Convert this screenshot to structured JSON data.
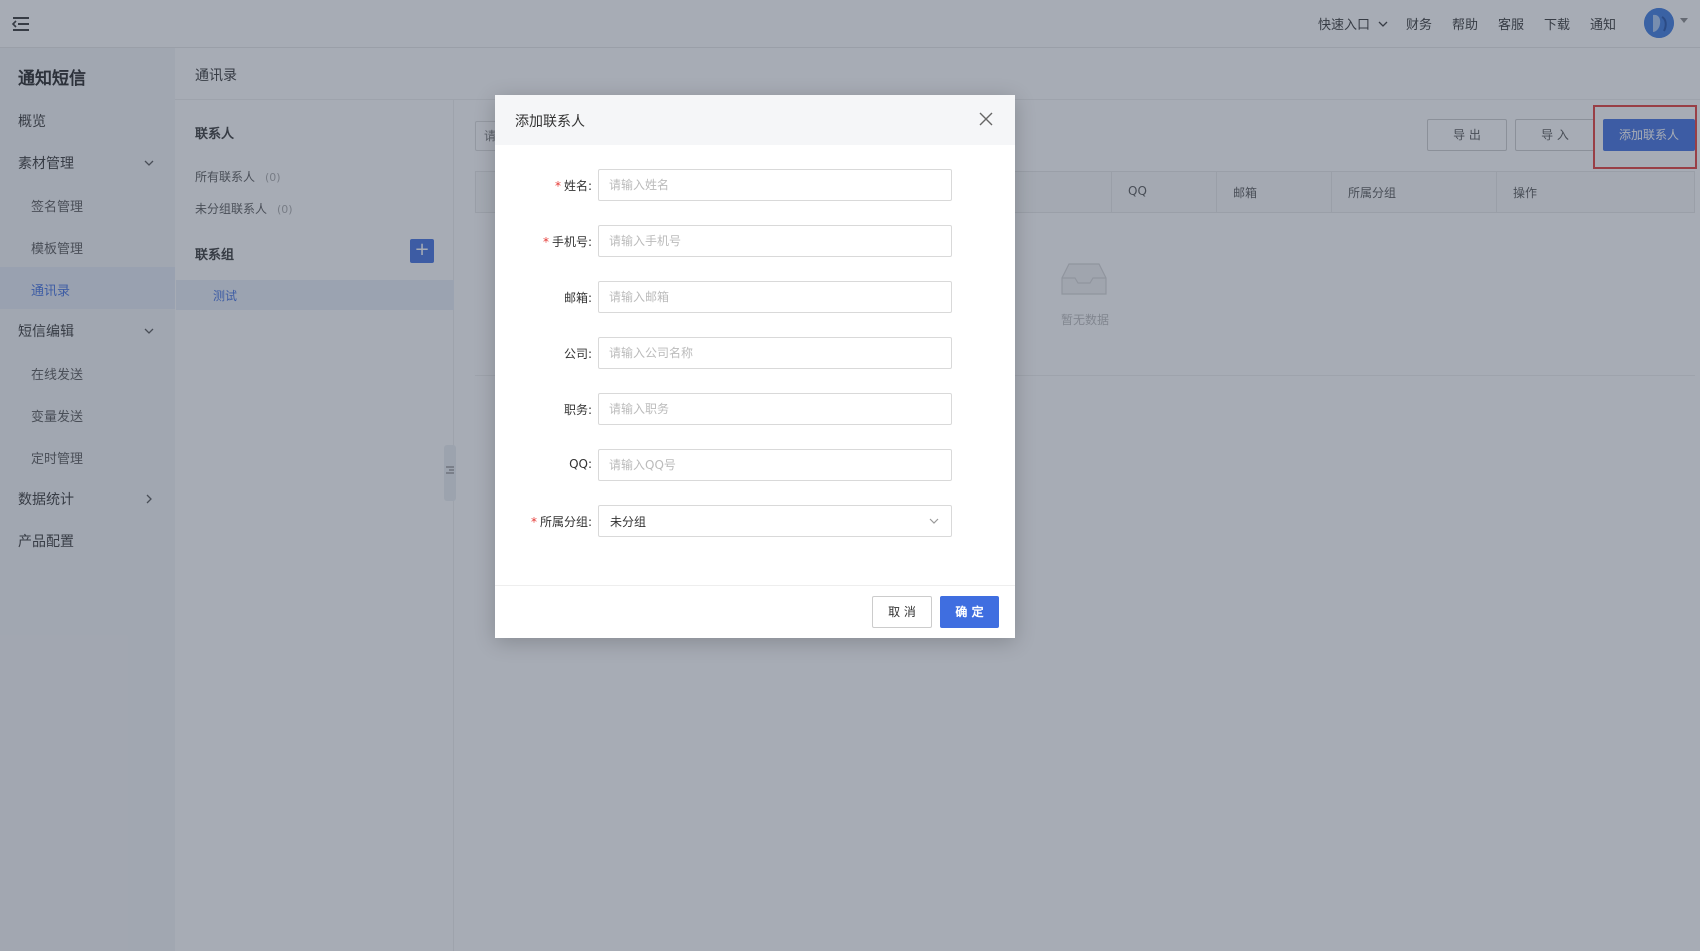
{
  "header": {
    "quick_entry": "快速入口",
    "links": [
      "财务",
      "帮助",
      "客服",
      "下载",
      "通知"
    ]
  },
  "sidebar": {
    "app_title": "通知短信",
    "overview": "概览",
    "material": "素材管理",
    "material_children": [
      "签名管理",
      "模板管理",
      "通讯录"
    ],
    "sms_edit": "短信编辑",
    "sms_children": [
      "在线发送",
      "变量发送",
      "定时管理"
    ],
    "stats": "数据统计",
    "product": "产品配置"
  },
  "breadcrumb": "通讯录",
  "contacts_panel": {
    "contacts_heading": "联系人",
    "all_contacts": "所有联系人",
    "all_count": "(0)",
    "ungrouped": "未分组联系人",
    "ungrouped_count": "(0)",
    "groups_heading": "联系组",
    "add_group_symbol": "+",
    "groups": [
      "测试"
    ]
  },
  "toolbar": {
    "search_placeholder": "请",
    "export": "导 出",
    "import": "导 入",
    "add_contact": "添加联系人"
  },
  "table": {
    "columns": [
      "QQ",
      "邮箱",
      "所属分组",
      "操作"
    ],
    "empty_text": "暂无数据"
  },
  "modal": {
    "title": "添加联系人",
    "fields": {
      "name_label": "姓名:",
      "name_placeholder": "请输入姓名",
      "phone_label": "手机号:",
      "phone_placeholder": "请输入手机号",
      "email_label": "邮箱:",
      "email_placeholder": "请输入邮箱",
      "company_label": "公司:",
      "company_placeholder": "请输入公司名称",
      "position_label": "职务:",
      "position_placeholder": "请输入职务",
      "qq_label": "QQ:",
      "qq_placeholder": "请输入QQ号",
      "group_label": "所属分组:",
      "group_value": "未分组"
    },
    "required_mark": "*",
    "cancel": "取 消",
    "confirm": "确 定"
  },
  "colors": {
    "primary": "#3f6ee0",
    "danger": "#e53935"
  }
}
